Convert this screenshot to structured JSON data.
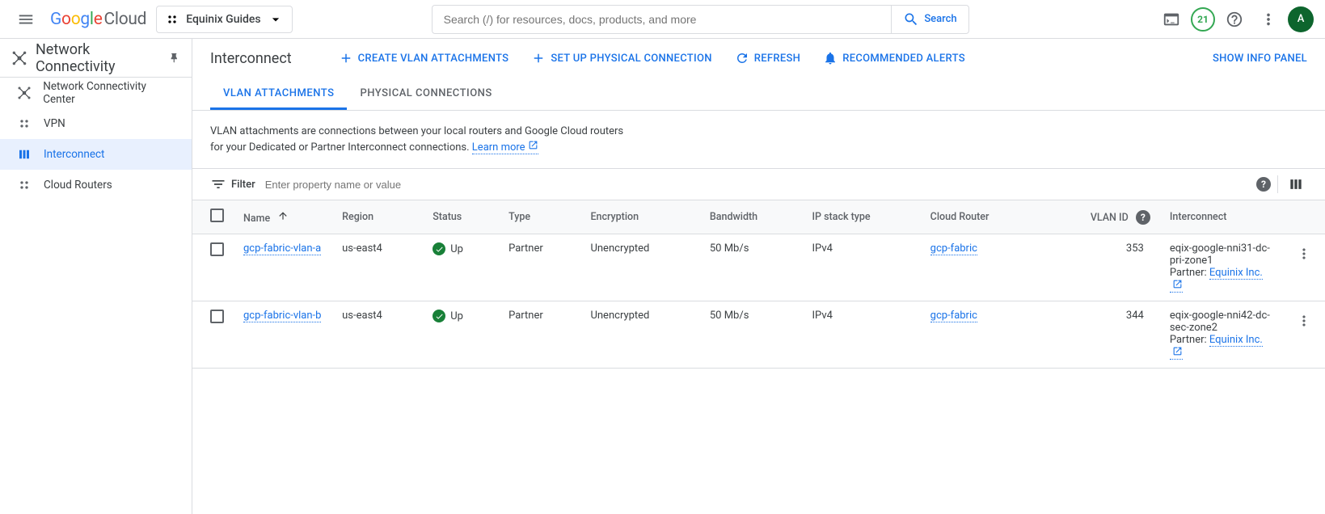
{
  "header": {
    "logo_cloud": "Cloud",
    "project": "Equinix Guides",
    "search_placeholder": "Search (/) for resources, docs, products, and more",
    "search_button": "Search",
    "badge": "21",
    "avatar": "A"
  },
  "sidebar": {
    "title": "Network Connectivity",
    "items": [
      {
        "label": "Network Connectivity Center"
      },
      {
        "label": "VPN"
      },
      {
        "label": "Interconnect"
      },
      {
        "label": "Cloud Routers"
      }
    ]
  },
  "page": {
    "title": "Interconnect",
    "actions": {
      "create": "CREATE VLAN ATTACHMENTS",
      "setup": "SET UP PHYSICAL CONNECTION",
      "refresh": "REFRESH",
      "alerts": "RECOMMENDED ALERTS",
      "info_panel": "SHOW INFO PANEL"
    },
    "tabs": [
      {
        "label": "VLAN ATTACHMENTS",
        "active": true
      },
      {
        "label": "PHYSICAL CONNECTIONS",
        "active": false
      }
    ],
    "description_1": "VLAN attachments are connections between your local routers and Google Cloud routers for your Dedicated or Partner Interconnect connections. ",
    "learn_more": "Learn more",
    "filter_label": "Filter",
    "filter_placeholder": "Enter property name or value"
  },
  "table": {
    "headers": {
      "name": "Name",
      "region": "Region",
      "status": "Status",
      "type": "Type",
      "encryption": "Encryption",
      "bandwidth": "Bandwidth",
      "ipstack": "IP stack type",
      "router": "Cloud Router",
      "vlanid": "VLAN ID",
      "interconnect": "Interconnect"
    },
    "rows": [
      {
        "name": "gcp-fabric-vlan-a",
        "region": "us-east4",
        "status": "Up",
        "type": "Partner",
        "encryption": "Unencrypted",
        "bandwidth": "50 Mb/s",
        "ipstack": "IPv4",
        "router": "gcp-fabric",
        "vlanid": "353",
        "interconnect": "eqix-google-nni31-dc-pri-zone1",
        "partner_label": "Partner: ",
        "partner_link": "Equinix Inc."
      },
      {
        "name": "gcp-fabric-vlan-b",
        "region": "us-east4",
        "status": "Up",
        "type": "Partner",
        "encryption": "Unencrypted",
        "bandwidth": "50 Mb/s",
        "ipstack": "IPv4",
        "router": "gcp-fabric",
        "vlanid": "344",
        "interconnect": "eqix-google-nni42-dc-sec-zone2",
        "partner_label": "Partner: ",
        "partner_link": "Equinix Inc."
      }
    ]
  }
}
